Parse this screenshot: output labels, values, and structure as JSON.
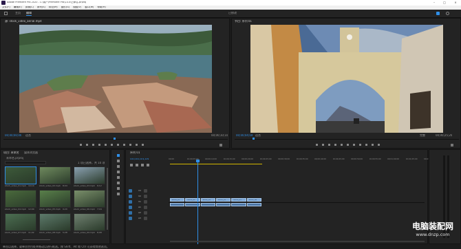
{
  "title_bar": {
    "title": "Adobe Premiere Pro 2020 - C:\\用户\\Premiere Pro\\14.0\\已命名.prproj"
  },
  "menu": [
    "文件(F)",
    "编辑(E)",
    "剪辑(C)",
    "序列(S)",
    "标记(M)",
    "图形(G)",
    "视图(V)",
    "窗口(W)",
    "帮助(H)"
  ],
  "workspace": {
    "tabs": [
      "主页",
      "编辑"
    ],
    "right_label": "已修改"
  },
  "source_monitor": {
    "tab": "源: stock_video_aerial.mp4",
    "timecode": "00;00;00;00",
    "fit": "适合",
    "duration": "00;00;10;10"
  },
  "program_monitor": {
    "tab": "节目: 序列 01",
    "timecode": "00;00;04;04",
    "fit": "适合",
    "full": "完整",
    "duration": "00;00;25;20"
  },
  "project_panel": {
    "tabs": [
      "项目: 未命名",
      "媒体浏览器"
    ],
    "project_file": "未命名.prproj",
    "count": "1 项已选择，共 10 项",
    "clips": [
      {
        "name": "stock_video_01.mp4",
        "dur": "10;10"
      },
      {
        "name": "stock_video_02.mp4",
        "dur": "8;04"
      },
      {
        "name": "stock_video_03.mp4",
        "dur": "6;12"
      },
      {
        "name": "stock_video_04.mp4",
        "dur": "12;00"
      },
      {
        "name": "stock_video_05.mp4",
        "dur": "9;20"
      },
      {
        "name": "stock_video_06.mp4",
        "dur": "7;16"
      },
      {
        "name": "stock_video_07.mp4",
        "dur": "11;02"
      },
      {
        "name": "stock_video_08.mp4",
        "dur": "5;28"
      },
      {
        "name": "stock_video_09.mp4",
        "dur": "8;08"
      }
    ]
  },
  "timeline": {
    "tab": "序列 01",
    "timecode": "00;00;04;04",
    "ruler": [
      "00;00",
      "00;00;05;00",
      "00;00;10;00",
      "00;00;15;00",
      "00;00;20;00",
      "00;00;25;00",
      "00;00;30;00",
      "00;00;35;00",
      "00;00;40;00",
      "00;00;45;00",
      "00;00;50;00",
      "00;00;55;00",
      "00;01;00;00",
      "00;01;05;00",
      "00;01;10;00"
    ],
    "tracks": [
      "V3",
      "V2",
      "V1",
      "A1",
      "A2",
      "A3"
    ],
    "clips": [
      "stock_01",
      "stock_02",
      "stock_03",
      "stock_04",
      "stock_05",
      "stock_06"
    ]
  },
  "status": {
    "text": "单击以选择，或单击空白处并拖动以进行框选。按 Shift、Alt 和 Ctrl 可获得其他选项。"
  },
  "watermark": {
    "cn": "电脑装配网",
    "url": "www.dnzp.com"
  },
  "colors": {
    "accent": "#2f8fe8",
    "clip": "#7aa6d6",
    "panel": "#232323"
  }
}
